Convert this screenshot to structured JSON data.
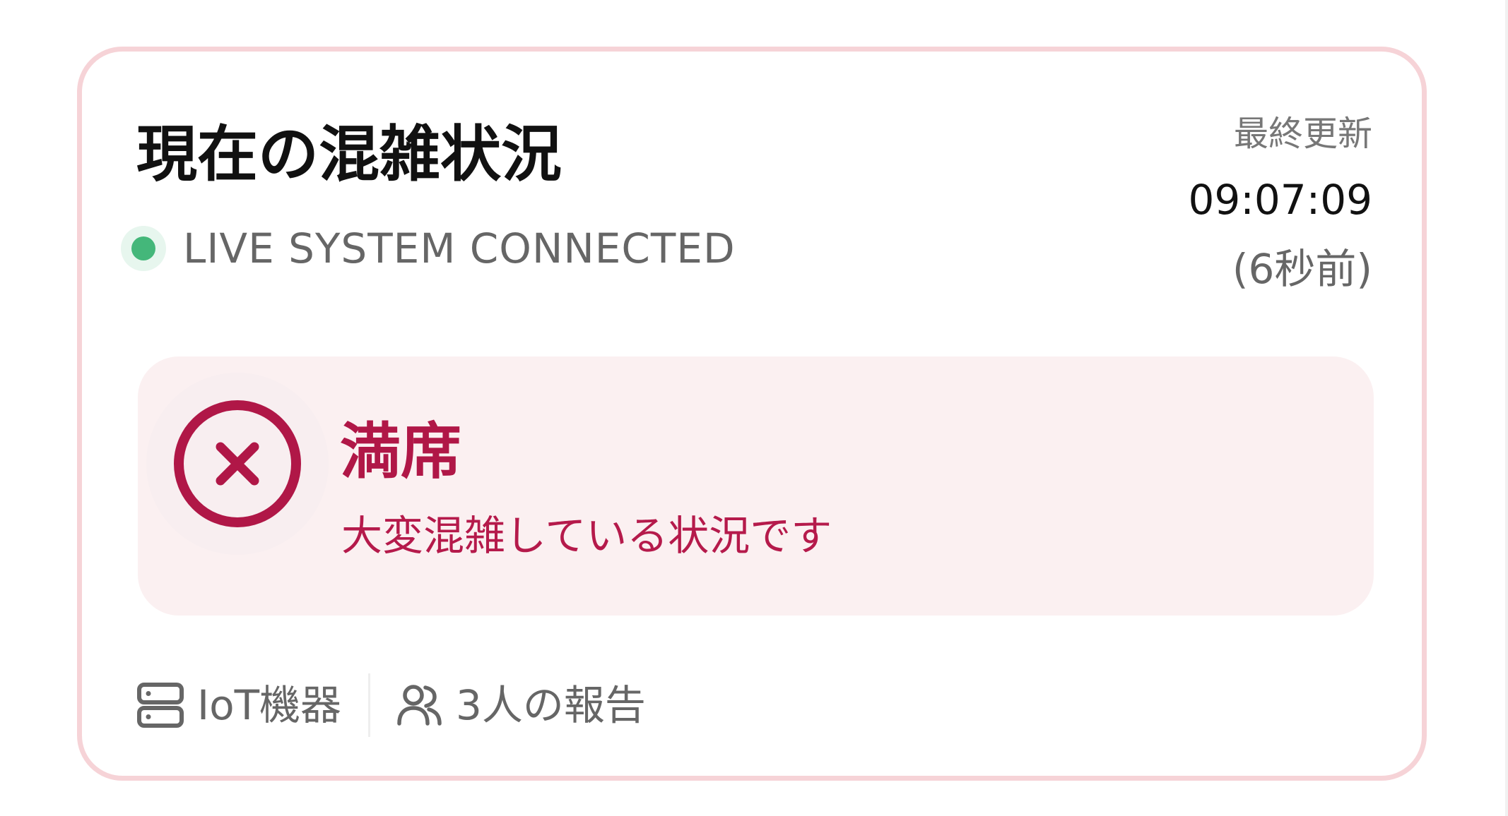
{
  "card": {
    "title": "現在の混雑状況",
    "connection_status": "LIVE SYSTEM CONNECTED",
    "last_updated": {
      "label": "最終更新",
      "time": "09:07:09",
      "relative": "(6秒前)"
    },
    "status": {
      "title": "満席",
      "message": "大変混雑している状況です",
      "icon": "x-circle-icon",
      "color": "#b01747",
      "background": "#fbf0f1"
    },
    "sources": [
      {
        "icon": "server-icon",
        "label": "IoT機器"
      },
      {
        "icon": "users-icon",
        "label": "3人の報告"
      }
    ]
  },
  "colors": {
    "card_border": "#f6d3d7",
    "live_indicator": "#44b77a",
    "text_primary": "#111111",
    "text_secondary": "#666666"
  }
}
